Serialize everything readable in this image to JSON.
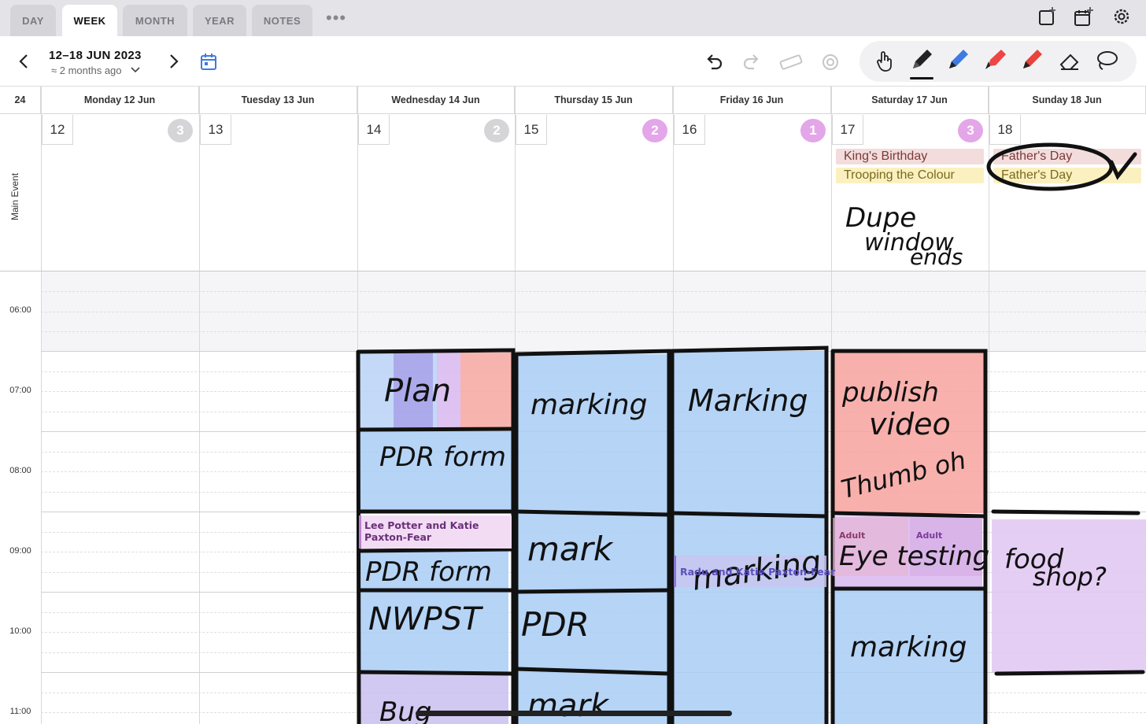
{
  "tabs": [
    {
      "label": "DAY",
      "active": false
    },
    {
      "label": "WEEK",
      "active": true
    },
    {
      "label": "MONTH",
      "active": false
    },
    {
      "label": "YEAR",
      "active": false
    },
    {
      "label": "NOTES",
      "active": false
    }
  ],
  "tab_more": "•••",
  "header_icons": [
    "new-note-icon",
    "new-event-icon",
    "settings-gear-icon"
  ],
  "toolbar": {
    "range_title": "12–18 JUN 2023",
    "range_sub": "≈ 2 months ago",
    "tools": [
      "undo-icon",
      "redo-icon",
      "ruler-icon",
      "touch-draw-icon"
    ],
    "pens": [
      "hand-icon",
      "pen-black-icon",
      "pen-blue-icon",
      "highlighter-red-icon",
      "pen-red-icon",
      "eraser-icon",
      "lasso-icon"
    ]
  },
  "calendar": {
    "week_number": "24",
    "main_event_label": "Main Event",
    "days": [
      {
        "header": "Monday 12 Jun",
        "num": "12",
        "badge": "3",
        "badge_color": "grey"
      },
      {
        "header": "Tuesday 13 Jun",
        "num": "13",
        "badge": "",
        "badge_color": ""
      },
      {
        "header": "Wednesday 14 Jun",
        "num": "14",
        "badge": "2",
        "badge_color": "grey"
      },
      {
        "header": "Thursday 15 Jun",
        "num": "15",
        "badge": "2",
        "badge_color": "pink"
      },
      {
        "header": "Friday 16 Jun",
        "num": "16",
        "badge": "1",
        "badge_color": "pink"
      },
      {
        "header": "Saturday 17 Jun",
        "num": "17",
        "badge": "3",
        "badge_color": "pink"
      },
      {
        "header": "Sunday 18 Jun",
        "num": "18",
        "badge": "",
        "badge_color": ""
      }
    ],
    "all_day_events": {
      "sat_1": "King's Birthday",
      "sat_2": "Trooping the Colour",
      "sun_1": "Father's Day",
      "sun_2": "Father's Day"
    },
    "hours": [
      "06:00",
      "07:00",
      "08:00",
      "09:00",
      "10:00",
      "11:00"
    ],
    "timed_events": {
      "wed_meeting": "Lee Potter and Katie Paxton-Fear",
      "fri_meeting": "Radu and Katie Paxton-Fear",
      "sat_adult_1": "Adult",
      "sat_adult_2": "Adult"
    }
  },
  "handwriting": {
    "sat_note_1": "Dupe",
    "sat_note_2": "window",
    "sat_note_3": "ends",
    "wed_1": "Plan",
    "wed_2": "PDR form",
    "wed_3": "PDR form",
    "wed_4": "NWPST",
    "wed_5": "Bug",
    "thu_1": "marking",
    "thu_2": "mark",
    "thu_3": "PDR",
    "thu_4": "mark",
    "fri_1": "Marking",
    "fri_2": "marking",
    "sat_1": "publish",
    "sat_2": "video",
    "sat_3": "Thumb oh",
    "sat_4": "Eye testing",
    "sat_5": "marking",
    "sun_1": "food",
    "sun_2": "shop?"
  },
  "colors": {
    "accent_blue": "#3d7be0",
    "highlight_blue": "#a9cdf5",
    "highlight_red": "#f7a39e",
    "highlight_purple": "#d9b8ef",
    "badge_pink": "#e3a6e8",
    "allday_red": "#f3dcdc",
    "allday_yellow": "#fbf0c0"
  }
}
